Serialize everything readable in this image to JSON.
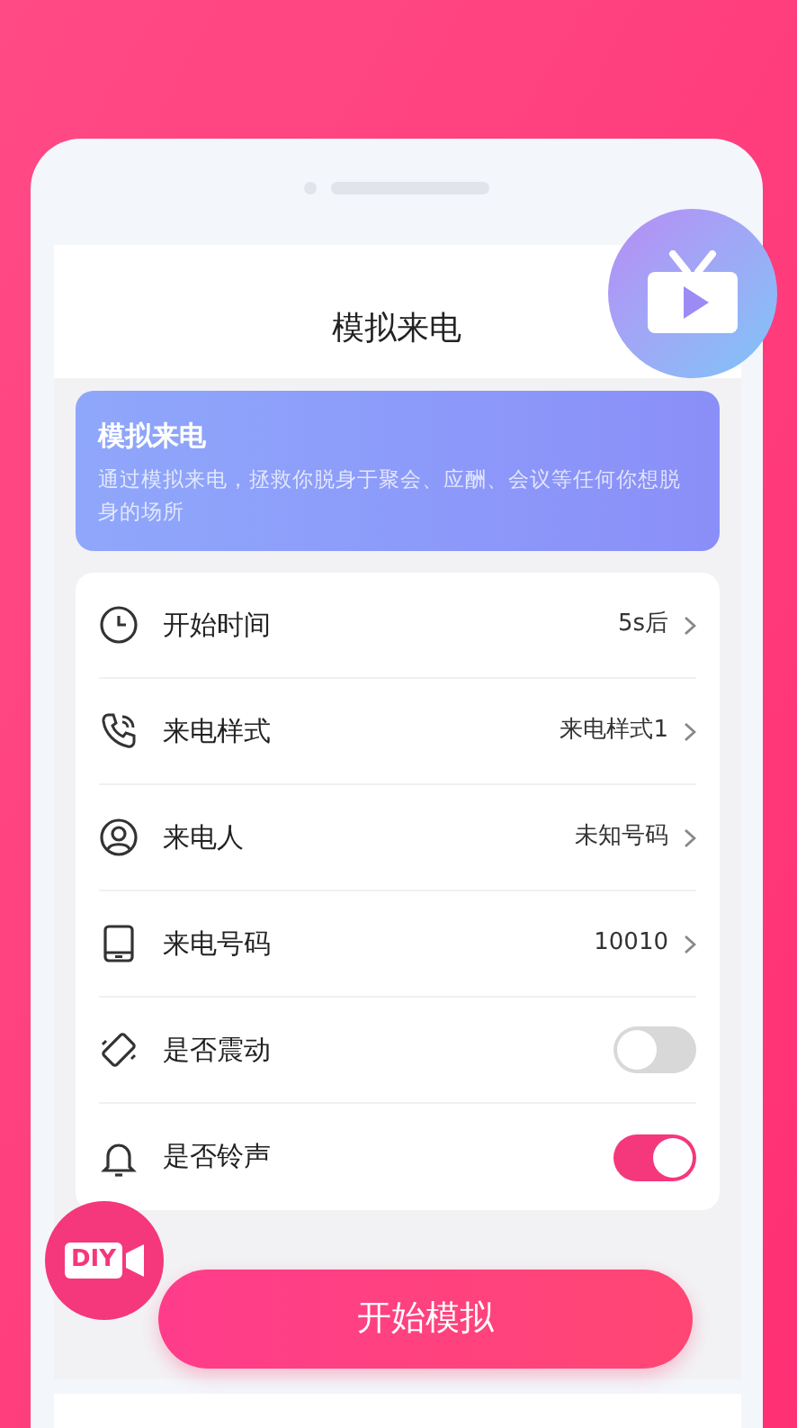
{
  "header": {
    "title": "模拟来电"
  },
  "banner": {
    "title": "模拟来电",
    "description": "通过模拟来电，拯救你脱身于聚会、应酬、会议等任何你想脱身的场所"
  },
  "settings": [
    {
      "kind": "link",
      "label": "开始时间",
      "value": "5s后"
    },
    {
      "kind": "link",
      "label": "来电样式",
      "value": "来电样式1"
    },
    {
      "kind": "link",
      "label": "来电人",
      "value": "未知号码"
    },
    {
      "kind": "link",
      "label": "来电号码",
      "value": "10010"
    },
    {
      "kind": "toggle",
      "label": "是否震动",
      "on": false
    },
    {
      "kind": "toggle",
      "label": "是否铃声",
      "on": true
    }
  ],
  "diy_badge": {
    "label": "DIY"
  },
  "start_button": {
    "label": "开始模拟"
  }
}
